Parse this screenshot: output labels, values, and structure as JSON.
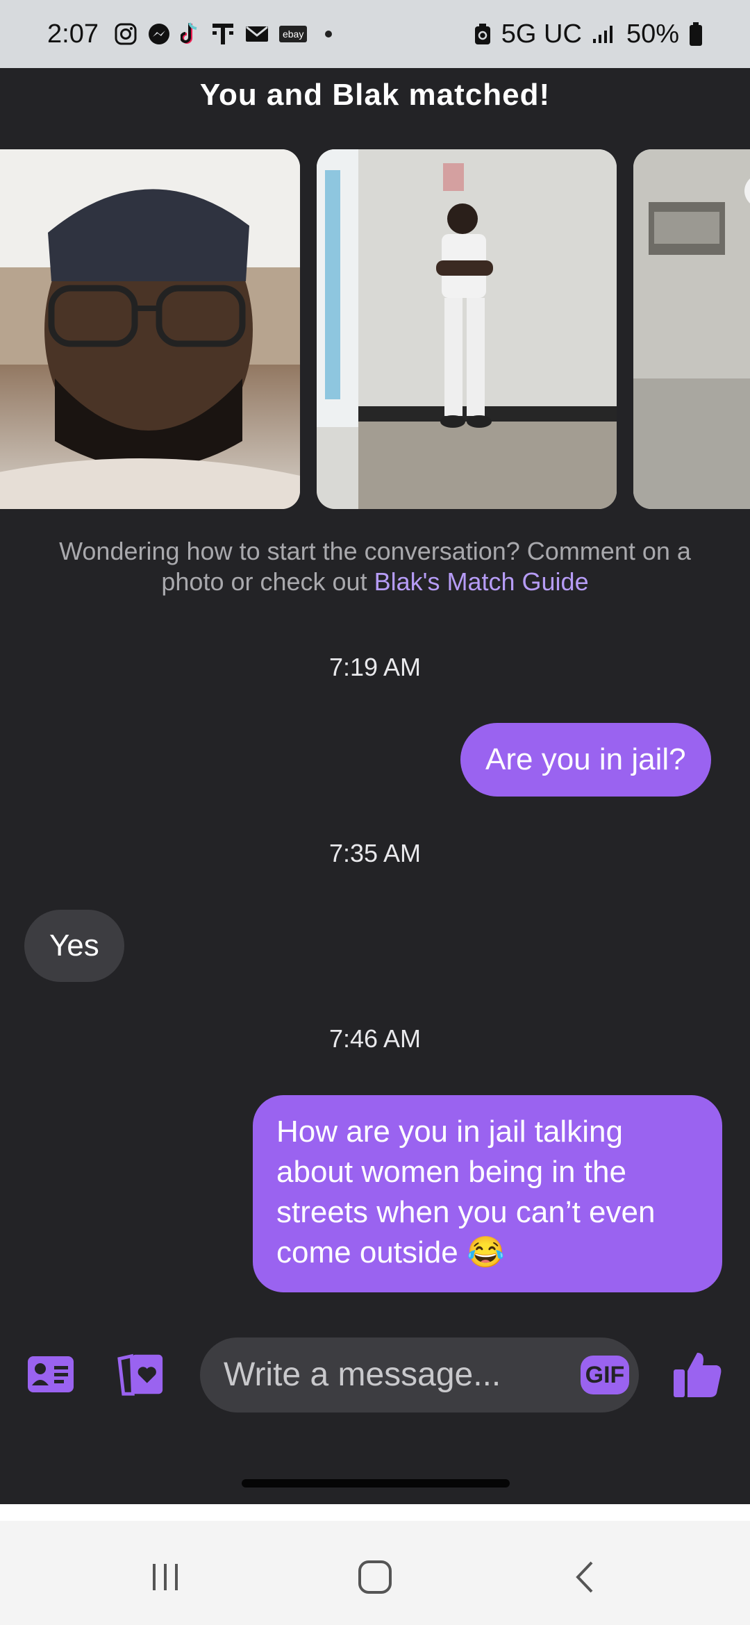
{
  "status_bar": {
    "time": "2:07",
    "left_icons": [
      "instagram-icon",
      "messenger-icon",
      "tiktok-icon",
      "t-mobile-icon",
      "mail-icon",
      "ebay-icon",
      "notification-dot-icon"
    ],
    "ebay_text": "ebay",
    "network": "5G UC",
    "battery": "50%"
  },
  "header": {
    "title": "You and Blak matched!"
  },
  "photos": [
    {
      "description_icon": "profile-photo-1"
    },
    {
      "description_icon": "profile-photo-2"
    },
    {
      "description_icon": "profile-photo-3"
    }
  ],
  "intro": {
    "text": "Wondering how to start the conversation? Comment on a photo or check out",
    "link": "Blak's Match Guide"
  },
  "messages": [
    {
      "timestamp": "7:19 AM",
      "direction": "sent",
      "text": "Are you in jail?"
    },
    {
      "timestamp": "7:35 AM",
      "direction": "received",
      "text": "Yes"
    },
    {
      "timestamp": "7:46 AM",
      "direction": "sent",
      "text": "How are you in jail talking about women being in the streets when you can’t even come outside",
      "emoji": "😂"
    }
  ],
  "compose": {
    "placeholder": "Write a message...",
    "gif_label": "GIF",
    "icons": [
      "profile-card-icon",
      "heart-card-icon",
      "thumbs-up-icon"
    ]
  },
  "nav_bar": {
    "icons": [
      "recent-apps-icon",
      "home-icon",
      "back-icon"
    ]
  },
  "colors": {
    "accent": "#9a63f0",
    "background": "#232326",
    "link": "#b69cf6"
  }
}
